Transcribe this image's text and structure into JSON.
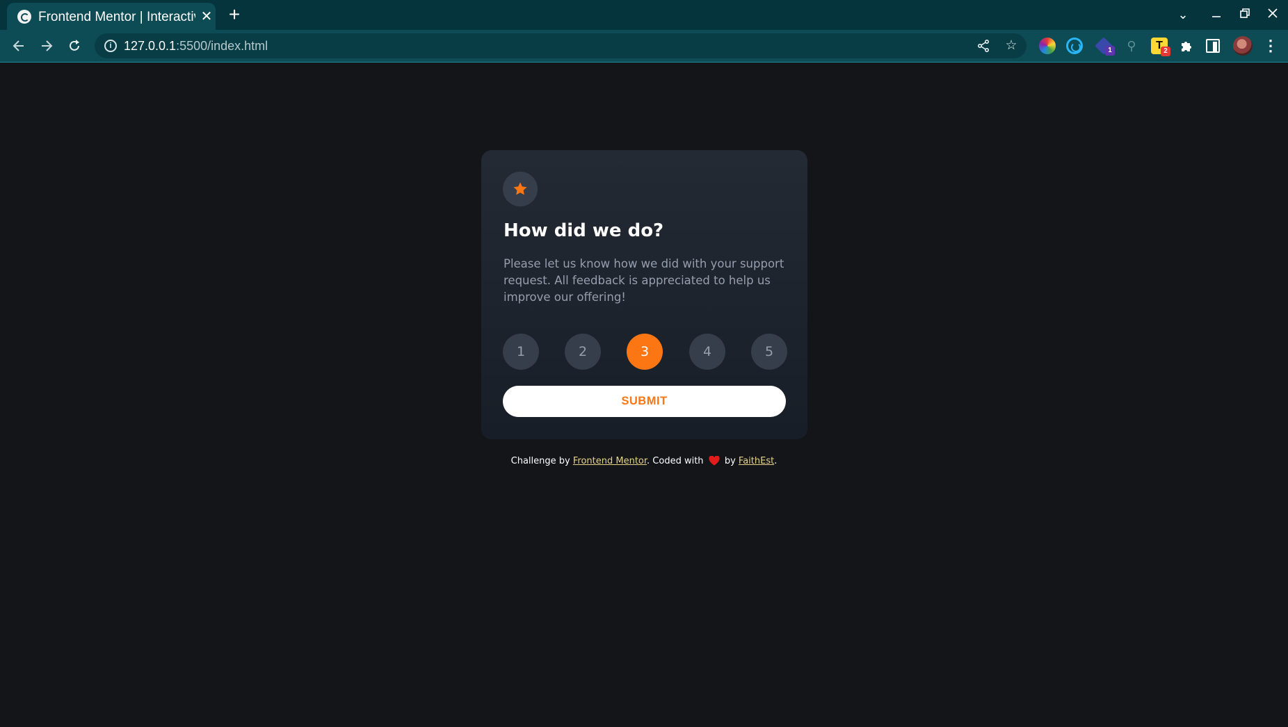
{
  "browser": {
    "tab_title": "Frontend Mentor | Interactive rating component",
    "tab_close": "✕",
    "new_tab": "+",
    "url_host": "127.0.0.1",
    "url_rest": ":5500/index.html",
    "extension_badges": {
      "cube": "1",
      "t_ext": "2"
    },
    "ext_t_label": "T"
  },
  "card": {
    "title": "How did we do?",
    "description": "Please let us know how we did with your support request. All feedback is appreciated to help us improve our offering!",
    "ratings": [
      "1",
      "2",
      "3",
      "4",
      "5"
    ],
    "selected_rating": "3",
    "submit_label": "SUBMIT"
  },
  "attribution": {
    "prefix": "Challenge by",
    "link1": "Frontend Mentor",
    "middle": ". Coded with",
    "by": "by",
    "link2": "FaithEst",
    "suffix": "."
  },
  "colors": {
    "page_bg": "#131518",
    "card_bg": "#232a34",
    "accent_orange": "#fc7614",
    "muted_text": "#969fad",
    "circle_bg": "#363e4b",
    "link_yellow": "#e7d387",
    "heart_red": "#e21b1b"
  },
  "icons": [
    "back-arrow-icon",
    "forward-arrow-icon",
    "reload-icon",
    "info-icon",
    "share-icon",
    "bookmark-star-icon",
    "extensions-puzzle-icon",
    "side-panel-icon",
    "profile-avatar",
    "menu-dots-icon",
    "star-icon",
    "heart-icon"
  ]
}
